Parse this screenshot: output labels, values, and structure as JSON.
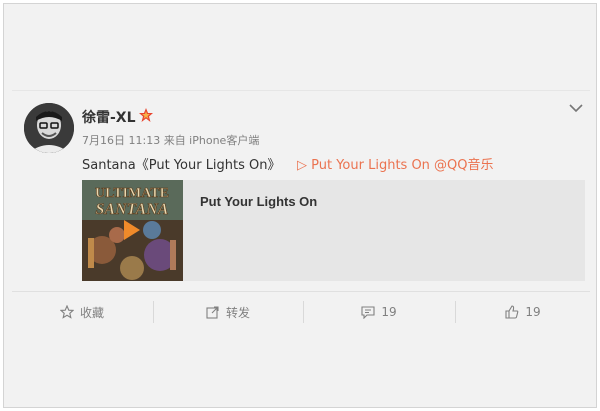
{
  "post": {
    "username": "徐雷-XL",
    "meta": "7月16日 11:13 来自 iPhone客户端",
    "text": "Santana《Put Your Lights On》",
    "link": "▷ Put Your Lights On @QQ音乐",
    "music_card": {
      "album_logo_line1": "ULTIMATE",
      "album_logo_line2": "SANTANA",
      "title": "Put Your Lights On"
    }
  },
  "actions": {
    "favorite_label": "收藏",
    "repost_label": "转发",
    "comment_count": "19",
    "like_count": "19"
  },
  "colors": {
    "link": "#eb7350",
    "vip_star": "#e8442e",
    "play_button": "#f08a2a"
  }
}
